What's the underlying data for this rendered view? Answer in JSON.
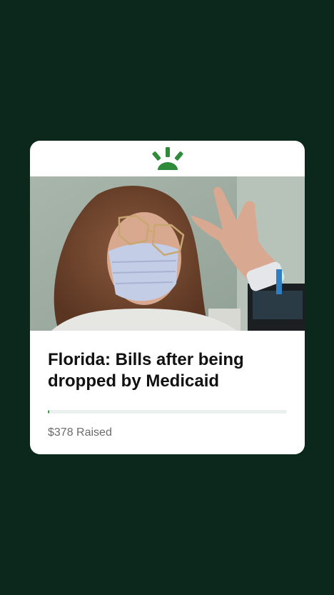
{
  "card": {
    "logo_icon": "gofundme-sun-icon",
    "brand_color": "#2f8a3a",
    "photo_description_icon": "campaign-photo",
    "title": "Florida: Bills after being dropped by Medicaid",
    "progress_fraction": 0.006,
    "raised_text": "$378 Raised"
  }
}
